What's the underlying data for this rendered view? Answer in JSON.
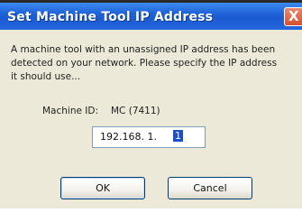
{
  "window": {
    "title": "Set Machine Tool IP Address",
    "close_glyph": "X",
    "close_icon": "close-icon"
  },
  "message": {
    "line1": "A machine tool with an unassigned IP address has been",
    "line2": "detected on your network. Please specify the IP address",
    "line3": "it should use..."
  },
  "machine": {
    "label": "Machine ID:",
    "value": "MC (7411)"
  },
  "ip_input": {
    "prefix": "192.168. 1.",
    "last_octet": "1"
  },
  "buttons": {
    "ok_label": "OK",
    "cancel_label": "Cancel"
  },
  "colors": {
    "titlebar": "#1f63d8",
    "dialog_bg": "#ece9d8",
    "selection": "#1e4fc6",
    "close_button": "#d4502e"
  }
}
